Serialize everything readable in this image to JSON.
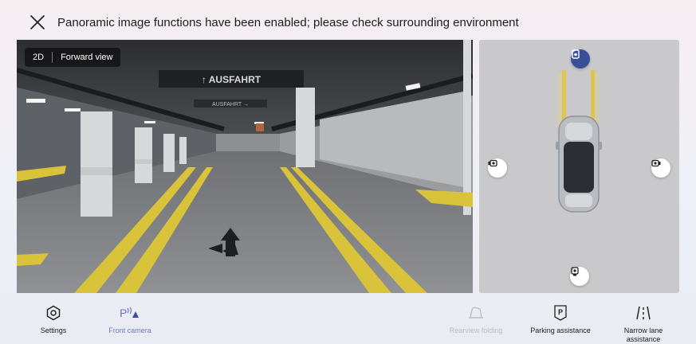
{
  "header": {
    "title": "Panoramic image functions have been enabled; please check surrounding environment"
  },
  "camera_view": {
    "mode_label": "2D",
    "view_label": "Forward view",
    "sign_text": "↑ AUSFAHRT",
    "small_sign_text": "AUSFAHRT →"
  },
  "toolbar": {
    "settings_label": "Settings",
    "front_camera_label": "Front camera",
    "rearview_folding_label": "Rearview folding",
    "parking_assistance_label": "Parking assistance",
    "narrow_lane_label_line1": "Narrow lane",
    "narrow_lane_label_line2": "assistance"
  },
  "colors": {
    "accent": "#3a4e9a",
    "active_label": "#6a7cc4",
    "disabled_label": "#b9bcc3",
    "lane_yellow": "#d8c33a"
  },
  "icons": {
    "close": "close-icon",
    "settings": "hexagon-gear-icon",
    "front_camera": "front-camera-icon",
    "rearview_folding": "mirror-fold-icon",
    "parking": "parking-icon",
    "narrow_lane": "narrow-lane-icon"
  }
}
